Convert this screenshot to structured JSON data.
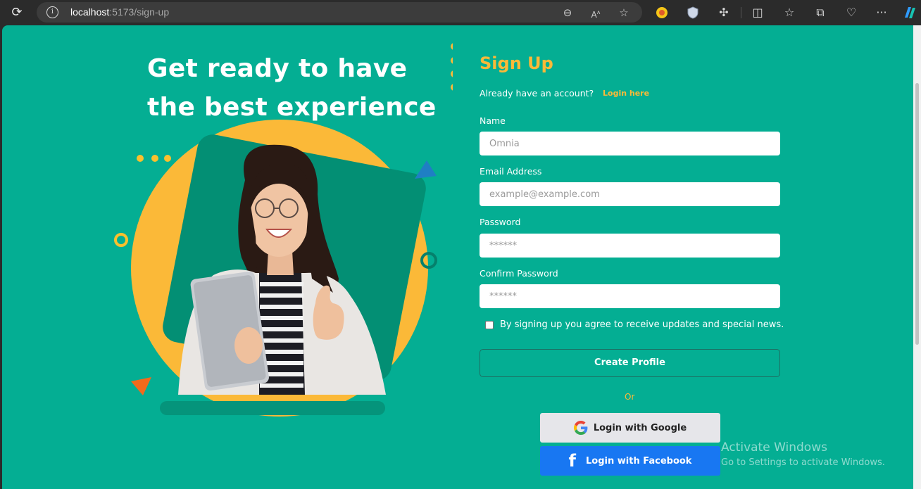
{
  "browser": {
    "url_host": "localhost",
    "url_path": ":5173/sign-up"
  },
  "hero": {
    "headline_line1": "Get ready to have",
    "headline_line2": "the best experience"
  },
  "form": {
    "title": "Sign Up",
    "have_account": "Already have an account?",
    "login_link": "Login here",
    "name_label": "Name",
    "name_placeholder": "Omnia",
    "email_label": "Email Address",
    "email_placeholder": "example@example.com",
    "password_label": "Password",
    "password_placeholder": "******",
    "confirm_label": "Confirm Password",
    "confirm_placeholder": "******",
    "agree_text": "By signing up you agree to receive updates and special news.",
    "create_button": "Create Profile",
    "or_text": "Or",
    "google_button": "Login with Google",
    "facebook_button": "Login with Facebook"
  },
  "watermark": {
    "line1": "Activate Windows",
    "line2": "Go to Settings to activate Windows."
  },
  "colors": {
    "background": "#04ae93",
    "accent": "#fbb938",
    "facebook": "#1877f2"
  }
}
